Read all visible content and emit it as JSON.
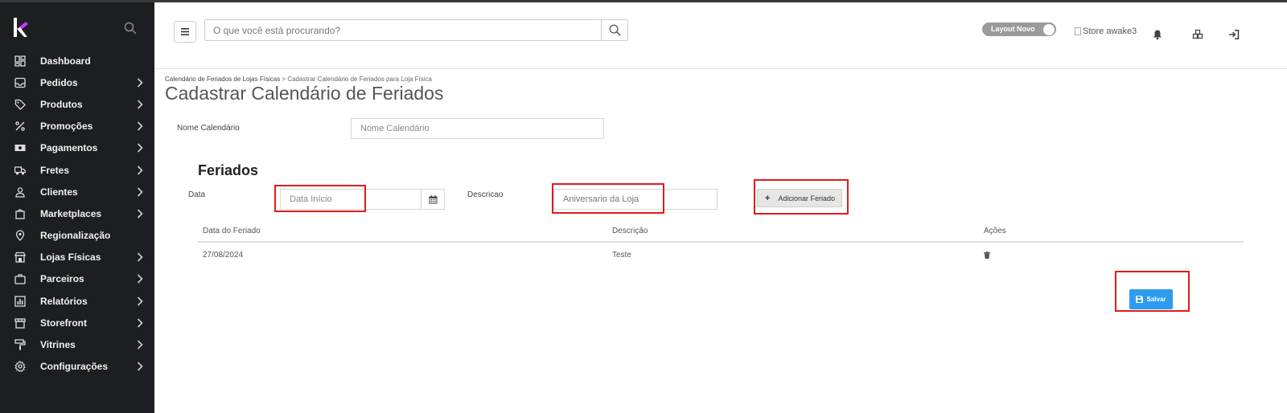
{
  "sidebar": {
    "items": [
      {
        "label": "Dashboard",
        "icon": "dashboard-icon",
        "has_children": false
      },
      {
        "label": "Pedidos",
        "icon": "inbox-icon",
        "has_children": true
      },
      {
        "label": "Produtos",
        "icon": "tag-icon",
        "has_children": true
      },
      {
        "label": "Promoções",
        "icon": "percent-icon",
        "has_children": true
      },
      {
        "label": "Pagamentos",
        "icon": "money-icon",
        "has_children": true
      },
      {
        "label": "Fretes",
        "icon": "truck-icon",
        "has_children": true
      },
      {
        "label": "Clientes",
        "icon": "user-icon",
        "has_children": true
      },
      {
        "label": "Marketplaces",
        "icon": "bag-icon",
        "has_children": true
      },
      {
        "label": "Regionalização",
        "icon": "location-icon",
        "has_children": false
      },
      {
        "label": "Lojas Físicas",
        "icon": "store-icon",
        "has_children": true
      },
      {
        "label": "Parceiros",
        "icon": "briefcase-icon",
        "has_children": true
      },
      {
        "label": "Relatórios",
        "icon": "report-icon",
        "has_children": true
      },
      {
        "label": "Storefront",
        "icon": "storefront-icon",
        "has_children": true
      },
      {
        "label": "Vitrines",
        "icon": "paint-roller-icon",
        "has_children": true
      },
      {
        "label": "Configurações",
        "icon": "gear-icon",
        "has_children": true
      }
    ]
  },
  "header": {
    "search_placeholder": "O que você está procurando?",
    "layout_toggle_label": "Layout Novo",
    "store_image_alt": "Store awake3"
  },
  "breadcrumb": {
    "parent": "Calendário de Feriados de Lojas Físicas",
    "separator": ">",
    "current": "Cadastrar Calendário de Feriados para Loja Física"
  },
  "page": {
    "title": "Cadastrar Calendário de Feriados",
    "nome_label": "Nome Calendário",
    "nome_placeholder": "Nome Calendário",
    "section_title": "Feriados",
    "data_label": "Data",
    "data_placeholder": "Data Início",
    "descricao_label": "Descricao",
    "descricao_value": "Aniversario da Loja",
    "add_button": "Adicionar Feriado",
    "save_button": "Salvar"
  },
  "table": {
    "headers": [
      "Data do Feriado",
      "Descrição",
      "Ações"
    ],
    "rows": [
      {
        "date": "27/08/2024",
        "description": "Teste",
        "action_icon": "trash-icon"
      }
    ]
  },
  "colors": {
    "sidebar_bg": "#1d1e21",
    "highlight": "#e01b1b",
    "primary": "#2d9cf0",
    "logo_accent": "#c13cff"
  }
}
